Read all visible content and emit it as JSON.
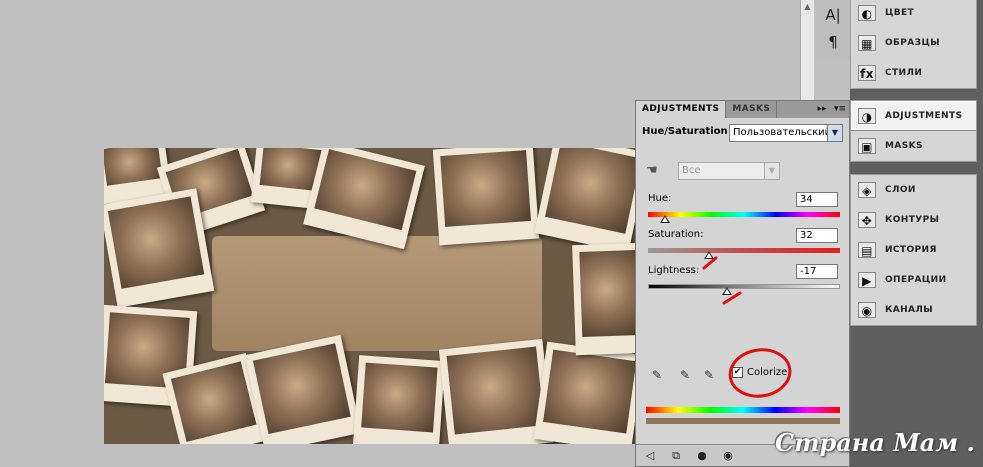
{
  "canvas": {
    "photo_description": "Sepia photo collage of polaroid baby pictures"
  },
  "tool_strip": {
    "items": [
      {
        "icon": "character-icon",
        "glyph": "A|"
      },
      {
        "icon": "paragraph-icon",
        "glyph": "¶"
      }
    ]
  },
  "dock": {
    "group1": [
      {
        "label": "ЦВЕТ",
        "icon": "color-palette-icon",
        "glyph": "◐"
      },
      {
        "label": "ОБРАЗЦЫ",
        "icon": "swatches-grid-icon",
        "glyph": "▦"
      },
      {
        "label": "СТИЛИ",
        "icon": "styles-fx-icon",
        "glyph": "fx"
      }
    ],
    "group2": [
      {
        "label": "ADJUSTMENTS",
        "icon": "adjustments-icon",
        "glyph": "◑",
        "active": true
      },
      {
        "label": "MASKS",
        "icon": "masks-icon",
        "glyph": "▣",
        "active": false
      }
    ],
    "group3": [
      {
        "label": "СЛОИ",
        "icon": "layers-icon",
        "glyph": "◈"
      },
      {
        "label": "КОНТУРЫ",
        "icon": "paths-icon",
        "glyph": "✥"
      },
      {
        "label": "ИСТОРИЯ",
        "icon": "history-icon",
        "glyph": "▤"
      },
      {
        "label": "ОПЕРАЦИИ",
        "icon": "actions-icon",
        "glyph": "▶"
      },
      {
        "label": "КАНАЛЫ",
        "icon": "channels-icon",
        "glyph": "◉"
      }
    ]
  },
  "adjustments_panel": {
    "tabs": [
      "ADJUSTMENTS",
      "MASKS"
    ],
    "title": "Hue/Saturation",
    "preset": "Пользовательский",
    "range": "Все",
    "hue": {
      "label": "Hue:",
      "value": "34",
      "fraction": 0.09
    },
    "saturation": {
      "label": "Saturation:",
      "value": "32",
      "fraction": 0.32
    },
    "lightness": {
      "label": "Lightness:",
      "value": "-17",
      "fraction": 0.41
    },
    "colorize": {
      "label": "Colorize",
      "checked": true
    },
    "colors": {
      "tint": "#8e7759"
    }
  },
  "watermark": {
    "text": "Страна Мам . ру"
  }
}
